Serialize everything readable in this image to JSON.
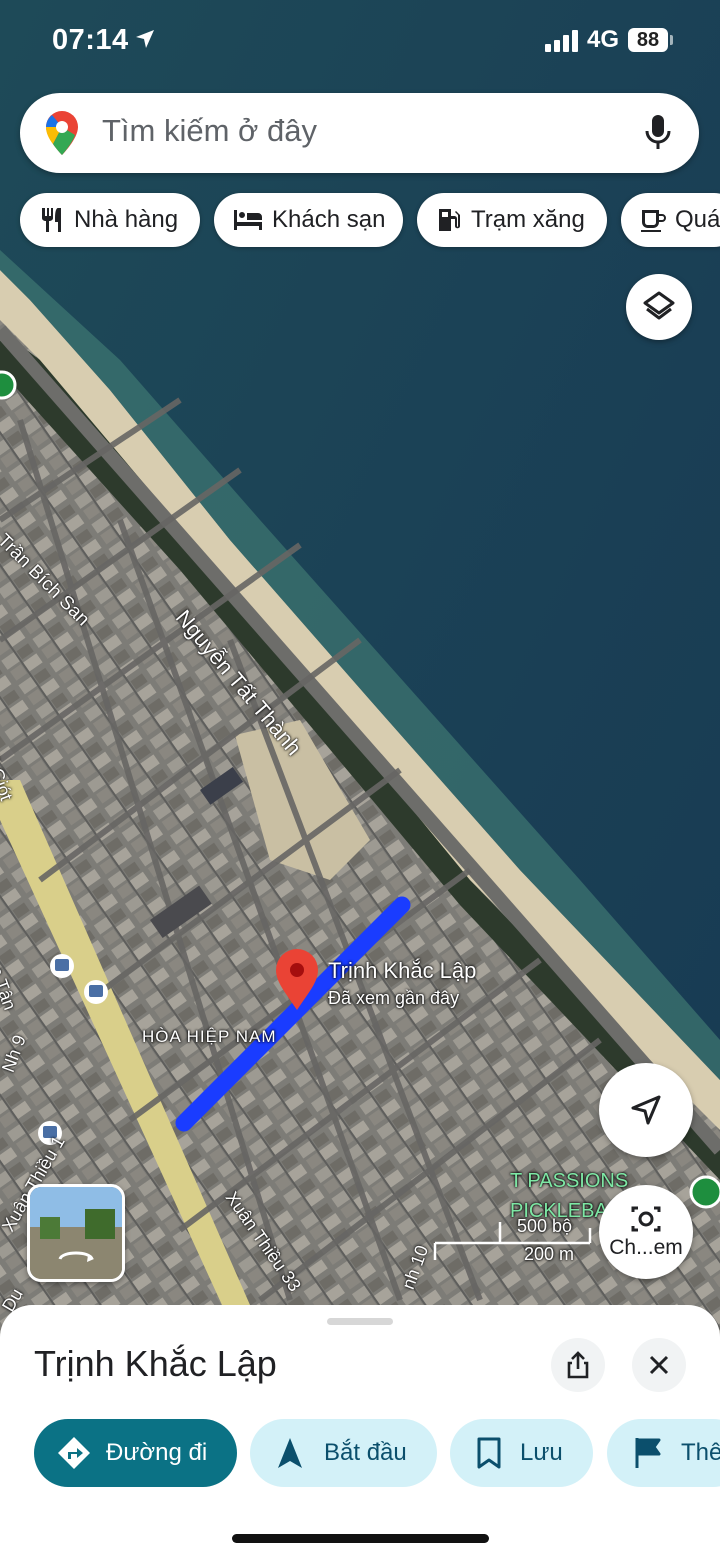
{
  "status": {
    "time": "07:14",
    "network": "4G",
    "battery": "88"
  },
  "search": {
    "placeholder": "Tìm kiếm ở đây"
  },
  "chips": [
    {
      "label": "Nhà hàng",
      "icon": "restaurant-icon"
    },
    {
      "label": "Khách sạn",
      "icon": "hotel-icon"
    },
    {
      "label": "Trạm xăng",
      "icon": "gas-station-icon"
    },
    {
      "label": "Quá",
      "icon": "cafe-icon"
    }
  ],
  "map": {
    "roads": [
      "Trần Bích San",
      "Nguyễn Tất Thành",
      "Xuân Thiều 33",
      "Võ Giót",
      "Lạc Tân",
      "Nh 9",
      "Xuân Thiều 1",
      "Du",
      "nh 10"
    ],
    "district": "HÒA HIỆP NAM",
    "place": {
      "name": "Trịnh Khắc Lập",
      "subtitle": "Đã xem gần đây"
    },
    "poi": "T PASSIONS PICKLEBA",
    "scale": {
      "feet": "500 bộ",
      "meters": "200 m"
    }
  },
  "buttons": {
    "search_in_image_label": "Ch...em"
  },
  "sheet": {
    "title": "Trịnh Khắc Lập",
    "actions": [
      {
        "label": "Đường đi",
        "icon": "directions-icon"
      },
      {
        "label": "Bắt đầu",
        "icon": "navigation-icon"
      },
      {
        "label": "Lưu",
        "icon": "bookmark-icon"
      },
      {
        "label": "Thê",
        "icon": "flag-icon"
      }
    ]
  },
  "colors": {
    "accent": "#0b7285",
    "route": "#1a3cff",
    "pin": "#ea4335",
    "action_bg": "#d3f1f8"
  }
}
